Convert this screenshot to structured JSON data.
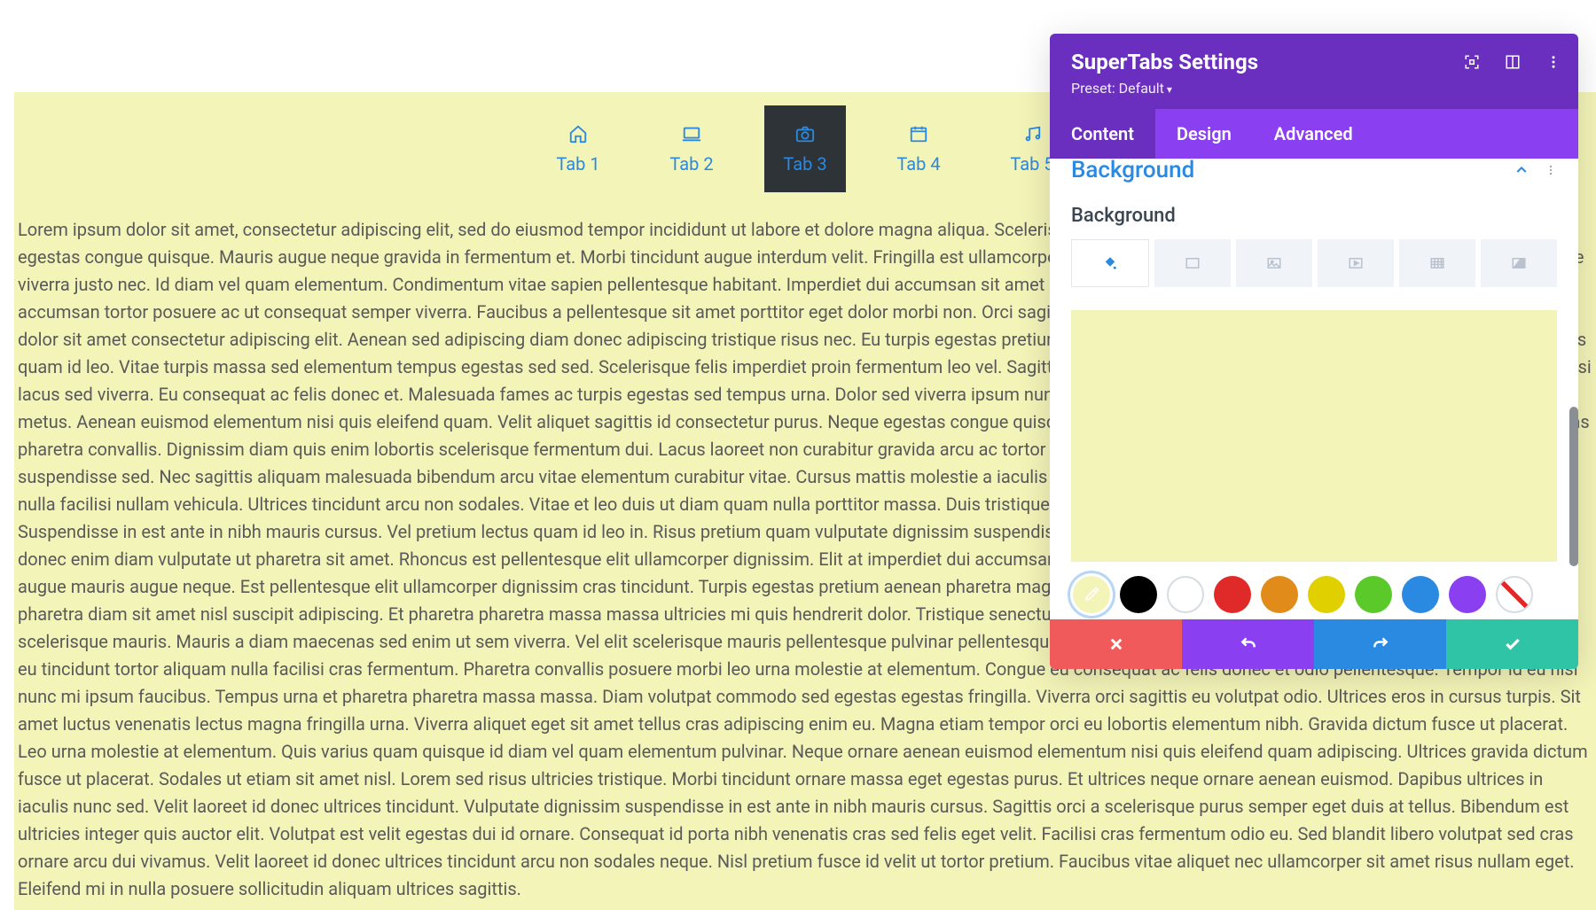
{
  "canvas": {
    "tabs": [
      {
        "label": "Tab 1",
        "icon": "home"
      },
      {
        "label": "Tab 2",
        "icon": "laptop"
      },
      {
        "label": "Tab 3",
        "icon": "camera",
        "active": true
      },
      {
        "label": "Tab 4",
        "icon": "calendar"
      },
      {
        "label": "Tab 5",
        "icon": "music"
      }
    ],
    "body": "Lorem ipsum dolor sit amet, consectetur adipiscing elit, sed do eiusmod tempor incididunt ut labore et dolore magna aliqua. Scelerisque purus semper eget duis at tellus at. In eu mi bibendum neque egestas congue quisque. Mauris augue neque gravida in fermentum et. Morbi tincidunt augue interdum velit. Fringilla est ullamcorper eget nulla facilisi. Sagittis nisl rhoncus mattis rhoncus urna neque viverra justo nec. Id diam vel quam elementum. Condimentum vitae sapien pellentesque habitant. Imperdiet dui accumsan sit amet nulla facilisi. Nunc id cursus metus aliquam eleifend. Lacus luctus accumsan tortor posuere ac ut consequat semper viverra. Faucibus a pellentesque sit amet porttitor eget dolor morbi non. Orci sagittis eu volutpat odio facilisis mauris sit amet. Posuere lorem ipsum dolor sit amet consectetur adipiscing elit. Aenean sed adipiscing diam donec adipiscing tristique risus nec. Eu turpis egestas pretium aenean pharetra magna ac placerat vestibulum. Vel pretium lectus quam id leo. Vitae turpis massa sed elementum tempus egestas sed sed. Scelerisque felis imperdiet proin fermentum leo vel. Sagittis orci a scelerisque purus semper eget. Ornare suspendisse sed nisi lacus sed viverra. Eu consequat ac felis donec et. Malesuada fames ac turpis egestas sed tempus urna. Dolor sed viverra ipsum nunc aliquet bibendum enim facilisis gravida. Urna nunc id cursus metus. Aenean euismod elementum nisi quis eleifend quam. Velit aliquet sagittis id consectetur purus. Neque egestas congue quisque egestas diam in arcu cursus. Fames ac turpis egestas maecenas pharetra convallis. Dignissim diam quis enim lobortis scelerisque fermentum dui. Lacus laoreet non curabitur gravida arcu ac tortor dignissim convallis. Ac tortor vitae purus faucibus ornare suspendisse sed. Nec sagittis aliquam malesuada bibendum arcu vitae elementum curabitur vitae. Cursus mattis molestie a iaculis at erat pellentesque adipiscing commodo. Nibh sit amet commodo nulla facilisi nullam vehicula. Ultrices tincidunt arcu non sodales. Vitae et leo duis ut diam quam nulla porttitor massa. Duis tristique sollicitudin nibh sit amet commodo nulla facilisi nullam. Suspendisse in est ante in nibh mauris cursus. Vel pretium lectus quam id leo in. Risus pretium quam vulputate dignissim suspendisse in est. Dui id ornare arcu odio ut sem nulla pharetra. Amet justo donec enim diam vulputate ut pharetra sit amet. Rhoncus est pellentesque elit ullamcorper dignissim. Elit at imperdiet dui accumsan sit amet nulla. Id interdum velit laoreet id donec ultrices. Auctor augue mauris augue neque. Est pellentesque elit ullamcorper dignissim cras tincidunt. Turpis egestas pretium aenean pharetra magna ac placerat. Rhoncus aenean vel elit scelerisque mauris. Nulla pharetra diam sit amet nisl suscipit adipiscing. Et pharetra pharetra massa massa ultricies mi quis hendrerit dolor. Tristique senectus et netus et malesuada fames ac turpis egestas. Aenean vel elit scelerisque mauris. Mauris a diam maecenas sed enim ut sem viverra. Vel elit scelerisque mauris pellentesque pulvinar pellentesque habitant morbi. Odio facilisis mauris sit amet. Tellus pellentesque eu tincidunt tortor aliquam nulla facilisi cras fermentum. Pharetra convallis posuere morbi leo urna molestie at elementum. Congue eu consequat ac felis donec et odio pellentesque. Tempor id eu nisl nunc mi ipsum faucibus. Tempus urna et pharetra pharetra massa massa. Diam volutpat commodo sed egestas egestas fringilla. Viverra orci sagittis eu volutpat odio. Ultrices eros in cursus turpis. Sit amet luctus venenatis lectus magna fringilla urna. Viverra aliquet eget sit amet tellus cras adipiscing enim eu. Magna etiam tempor orci eu lobortis elementum nibh. Gravida dictum fusce ut placerat. Leo urna molestie at elementum. Quis varius quam quisque id diam vel quam elementum pulvinar. Neque ornare aenean euismod elementum nisi quis eleifend quam adipiscing. Ultrices gravida dictum fusce ut placerat. Sodales ut etiam sit amet nisl. Lorem sed risus ultricies tristique. Morbi tincidunt ornare massa eget egestas purus. Et ultrices neque ornare aenean euismod. Dapibus ultrices in iaculis nunc sed. Velit laoreet id donec ultrices tincidunt. Vulputate dignissim suspendisse in est ante in nibh mauris cursus. Sagittis orci a scelerisque purus semper eget duis at tellus. Bibendum est ultricies integer quis auctor elit. Volutpat est velit egestas dui id ornare. Consequat id porta nibh venenatis cras sed felis eget velit. Facilisi cras fermentum odio eu. Sed blandit libero volutpat sed cras ornare arcu dui vivamus. Velit laoreet id donec ultrices tincidunt arcu non sodales neque. Nisl pretium fusce id velit ut tortor pretium. Faucibus vitae aliquet nec ullamcorper sit amet risus nullam eget. Eleifend mi in nulla posuere sollicitudin aliquam ultrices sagittis."
  },
  "panel": {
    "title": "SuperTabs Settings",
    "preset_label": "Preset: Default",
    "tabs": {
      "content": "Content",
      "design": "Design",
      "advanced": "Advanced",
      "active": "Content"
    },
    "section": {
      "heading": "Background",
      "sublabel": "Background",
      "bg_types": [
        {
          "name": "color",
          "active": true
        },
        {
          "name": "gradient"
        },
        {
          "name": "image"
        },
        {
          "name": "video"
        },
        {
          "name": "pattern"
        },
        {
          "name": "mask"
        }
      ],
      "preview_color": "#f3f4b8",
      "swatches": [
        {
          "name": "eyedropper",
          "type": "tool",
          "selected": true
        },
        {
          "name": "black",
          "color": "#000000"
        },
        {
          "name": "white",
          "color": "#ffffff"
        },
        {
          "name": "red",
          "color": "#e02a2a"
        },
        {
          "name": "orange",
          "color": "#e08b1a"
        },
        {
          "name": "yellow",
          "color": "#e0d000"
        },
        {
          "name": "green",
          "color": "#5bc92a"
        },
        {
          "name": "blue",
          "color": "#2a89e0"
        },
        {
          "name": "purple",
          "color": "#8a3ff0"
        },
        {
          "name": "none",
          "type": "none"
        }
      ]
    },
    "footer": {
      "cancel": "cancel",
      "undo": "undo",
      "redo": "redo",
      "save": "save"
    }
  }
}
